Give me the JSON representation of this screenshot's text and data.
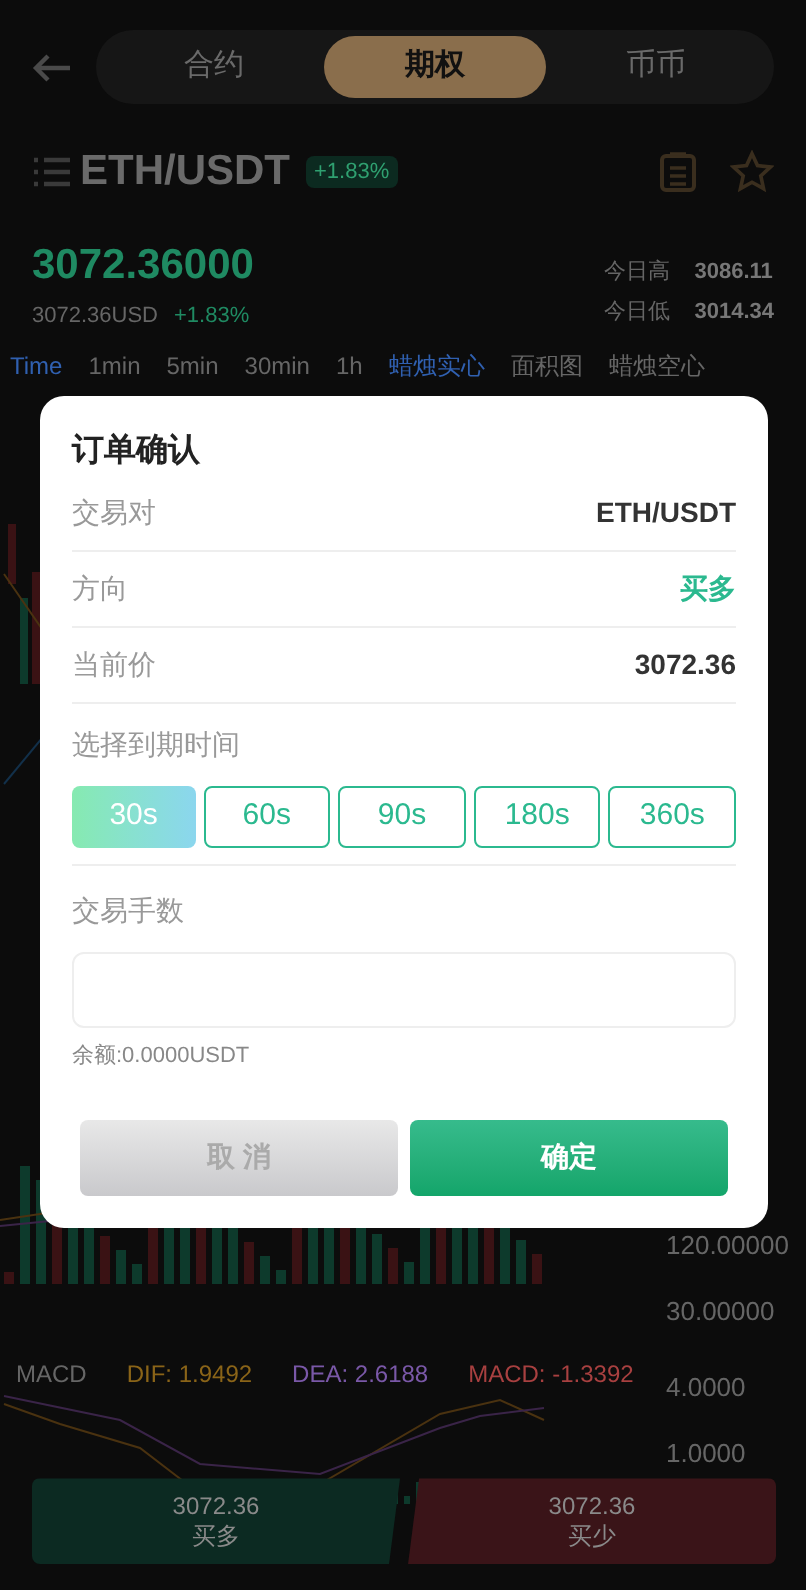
{
  "header": {
    "tabs": [
      {
        "label": "合约",
        "selected": false
      },
      {
        "label": "期权",
        "selected": true
      },
      {
        "label": "币币",
        "selected": false
      }
    ]
  },
  "pair": {
    "symbol": "ETH/USDT",
    "change": "+1.83%",
    "price": "3072.36000",
    "price_usd": "3072.36USD",
    "price_change": "+1.83%",
    "stats": [
      {
        "label": "今日高",
        "value": "3086.11"
      },
      {
        "label": "今日低",
        "value": "3014.34"
      }
    ]
  },
  "chart_tabs": [
    {
      "label": "Time",
      "selected": true
    },
    {
      "label": "1min",
      "selected": false
    },
    {
      "label": "5min",
      "selected": false
    },
    {
      "label": "30min",
      "selected": false
    },
    {
      "label": "1h",
      "selected": false
    },
    {
      "label": "蜡烛实心",
      "selected": true
    },
    {
      "label": "面积图",
      "selected": false
    },
    {
      "label": "蜡烛空心",
      "selected": false
    }
  ],
  "axis_labels": [
    "120.00000",
    "30.00000",
    "4.0000",
    "1.0000"
  ],
  "macd": {
    "title": "MACD",
    "dif": "DIF: 1.9492",
    "dea": "DEA: 2.6188",
    "macd": "MACD: -1.3392"
  },
  "actions": [
    {
      "price": "3072.36",
      "label": "买多",
      "kind": "buy"
    },
    {
      "price": "3072.36",
      "label": "买少",
      "kind": "sell"
    }
  ],
  "dialog": {
    "title": "订单确认",
    "rows": [
      {
        "label": "交易对",
        "value": "ETH/USDT",
        "kind": "plain"
      },
      {
        "label": "方向",
        "value": "买多",
        "kind": "direction"
      },
      {
        "label": "当前价",
        "value": "3072.36",
        "kind": "plain"
      }
    ],
    "expiry_label": "选择到期时间",
    "durations": [
      {
        "label": "30s",
        "selected": true
      },
      {
        "label": "60s",
        "selected": false
      },
      {
        "label": "90s",
        "selected": false
      },
      {
        "label": "180s",
        "selected": false
      },
      {
        "label": "360s",
        "selected": false
      }
    ],
    "amount_label": "交易手数",
    "balance": "余额:0.0000USDT",
    "cancel": "取 消",
    "confirm": "确定"
  }
}
